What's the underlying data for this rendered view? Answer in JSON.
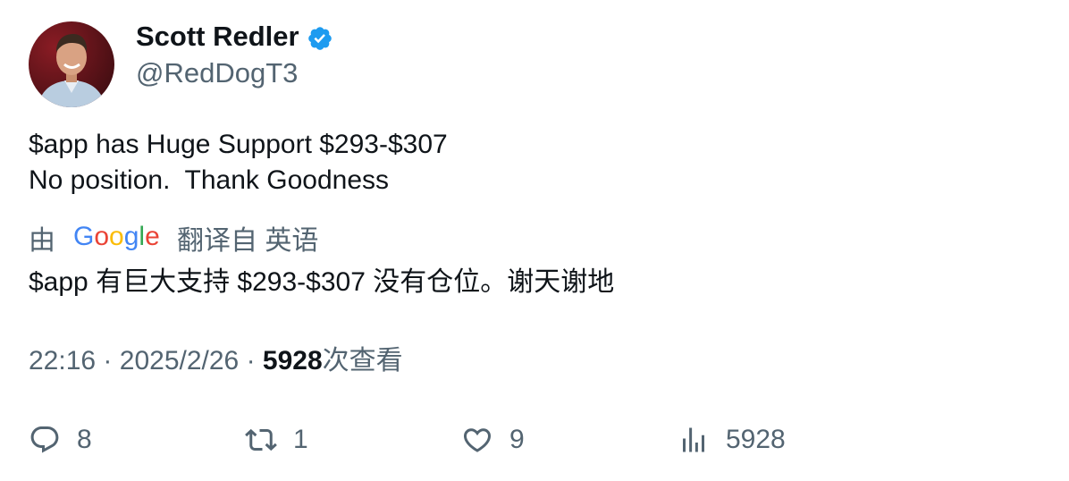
{
  "author": {
    "name": "Scott Redler",
    "handle": "@RedDogT3",
    "verified_color": "#1d9bf0"
  },
  "tweet": {
    "lines": [
      "$app has Huge Support $293-$307",
      "No position.  Thank Goodness"
    ]
  },
  "translation": {
    "prefix": "由",
    "provider": "Google",
    "suffix": "翻译自 英语",
    "text": "$app 有巨大支持 $293-$307 没有仓位。谢天谢地"
  },
  "meta": {
    "time": "22:16",
    "separator": "·",
    "date": "2025/2/26",
    "views": "5928",
    "views_label": "次查看"
  },
  "actions": {
    "replies": "8",
    "retweets": "1",
    "likes": "9",
    "views": "5928"
  },
  "colors": {
    "text": "#0f1419",
    "secondary": "#536471",
    "brand": "#1d9bf0"
  }
}
